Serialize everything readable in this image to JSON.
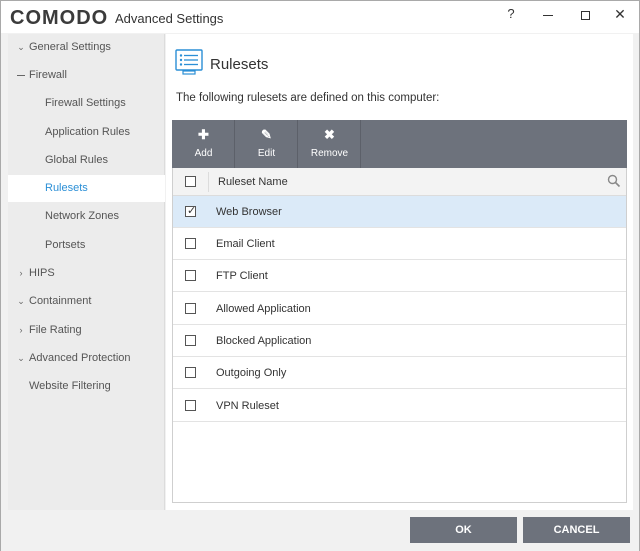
{
  "window": {
    "logo": "COMODO",
    "title": "Advanced Settings",
    "help_label": "?",
    "close_label": "✕"
  },
  "sidebar": {
    "items": [
      {
        "label": "General Settings",
        "chevron": "chevron-down"
      },
      {
        "label": "Firewall",
        "chevron": "collapse-dash"
      },
      {
        "label": "Firewall Settings"
      },
      {
        "label": "Application Rules"
      },
      {
        "label": "Global Rules"
      },
      {
        "label": "Rulesets"
      },
      {
        "label": "Network Zones"
      },
      {
        "label": "Portsets"
      },
      {
        "label": "HIPS",
        "chevron": "chevron-right"
      },
      {
        "label": "Containment",
        "chevron": "chevron-down"
      },
      {
        "label": "File Rating",
        "chevron": "chevron-right"
      },
      {
        "label": "Advanced Protection",
        "chevron": "chevron-down"
      },
      {
        "label": "Website Filtering"
      }
    ],
    "active": "Rulesets"
  },
  "main": {
    "title": "Rulesets",
    "intro": "The following rulesets are defined on this computer:",
    "toolbar": {
      "add_icon": "✚",
      "add_label": "Add",
      "edit_icon": "✎",
      "edit_label": "Edit",
      "remove_icon": "✖",
      "remove_label": "Remove"
    },
    "table": {
      "header": "Ruleset Name",
      "rows": [
        {
          "name": "Web Browser",
          "checked": true
        },
        {
          "name": "Email Client",
          "checked": false
        },
        {
          "name": "FTP Client",
          "checked": false
        },
        {
          "name": "Allowed Application",
          "checked": false
        },
        {
          "name": "Blocked Application",
          "checked": false
        },
        {
          "name": "Outgoing Only",
          "checked": false
        },
        {
          "name": "VPN Ruleset",
          "checked": false
        }
      ],
      "check_glyph": "✓"
    }
  },
  "footer": {
    "ok_label": "OK",
    "cancel_label": "CANCEL"
  },
  "colors": {
    "accent": "#2b8fd6",
    "toolbar": "#6d727c",
    "selected_row": "#dbeaf8"
  }
}
